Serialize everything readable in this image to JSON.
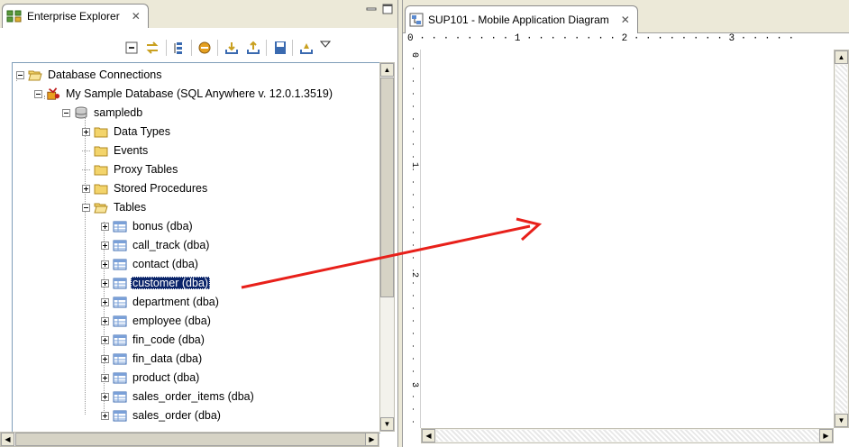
{
  "left_panel": {
    "tab_title": "Enterprise Explorer",
    "close_glyph": "✕",
    "tree": [
      {
        "label": "Database Connections",
        "level": 0,
        "expander": "minus",
        "icon": "folder-open-icon",
        "name": "tree-item-database-connections"
      },
      {
        "label": "My Sample Database (SQL Anywhere v. 12.0.1.3519)",
        "level": 1,
        "expander": "minus",
        "icon": "database-connection-icon",
        "name": "tree-item-my-sample-database"
      },
      {
        "label": "sampledb",
        "level": 2,
        "expander": "minus",
        "icon": "database-icon",
        "name": "tree-item-sampledb"
      },
      {
        "label": "Data Types",
        "level": 3,
        "expander": "plus",
        "icon": "folder-icon",
        "name": "tree-item-data-types"
      },
      {
        "label": "Events",
        "level": 3,
        "expander": "none",
        "icon": "folder-icon",
        "name": "tree-item-events"
      },
      {
        "label": "Proxy Tables",
        "level": 3,
        "expander": "none",
        "icon": "folder-icon",
        "name": "tree-item-proxy-tables"
      },
      {
        "label": "Stored Procedures",
        "level": 3,
        "expander": "plus",
        "icon": "folder-icon",
        "name": "tree-item-stored-procedures"
      },
      {
        "label": "Tables",
        "level": 3,
        "expander": "minus",
        "icon": "folder-open-icon",
        "name": "tree-item-tables"
      },
      {
        "label": "bonus (dba)",
        "level": 4,
        "expander": "plus",
        "icon": "table-icon",
        "name": "tree-item-bonus"
      },
      {
        "label": "call_track (dba)",
        "level": 4,
        "expander": "plus",
        "icon": "table-icon",
        "name": "tree-item-call-track"
      },
      {
        "label": "contact (dba)",
        "level": 4,
        "expander": "plus",
        "icon": "table-icon",
        "name": "tree-item-contact"
      },
      {
        "label": "customer (dba)",
        "level": 4,
        "expander": "plus",
        "icon": "table-icon",
        "name": "tree-item-customer",
        "selected": true
      },
      {
        "label": "department (dba)",
        "level": 4,
        "expander": "plus",
        "icon": "table-icon",
        "name": "tree-item-department"
      },
      {
        "label": "employee (dba)",
        "level": 4,
        "expander": "plus",
        "icon": "table-icon",
        "name": "tree-item-employee"
      },
      {
        "label": "fin_code (dba)",
        "level": 4,
        "expander": "plus",
        "icon": "table-icon",
        "name": "tree-item-fin-code"
      },
      {
        "label": "fin_data (dba)",
        "level": 4,
        "expander": "plus",
        "icon": "table-icon",
        "name": "tree-item-fin-data"
      },
      {
        "label": "product (dba)",
        "level": 4,
        "expander": "plus",
        "icon": "table-icon",
        "name": "tree-item-product"
      },
      {
        "label": "sales_order_items (dba)",
        "level": 4,
        "expander": "plus",
        "icon": "table-icon",
        "name": "tree-item-sales-order-items"
      },
      {
        "label": "sales_order (dba)",
        "level": 4,
        "expander": "plus",
        "icon": "table-icon",
        "name": "tree-item-sales-order"
      }
    ]
  },
  "right_panel": {
    "tab_title": "SUP101 - Mobile Application Diagram",
    "close_glyph": "✕",
    "ruler_top_text": "0 · · · · · · · · 1 · · · · · · · · 2 · · · · · · · · 3 · · · · ·",
    "ruler_left_marks": [
      "0",
      "1",
      "2",
      "3"
    ]
  },
  "annotation": {
    "color": "#e8201a"
  },
  "colors": {
    "selection": "#0a246a",
    "folder": "#f3d46b",
    "chrome": "#ece9d8"
  }
}
